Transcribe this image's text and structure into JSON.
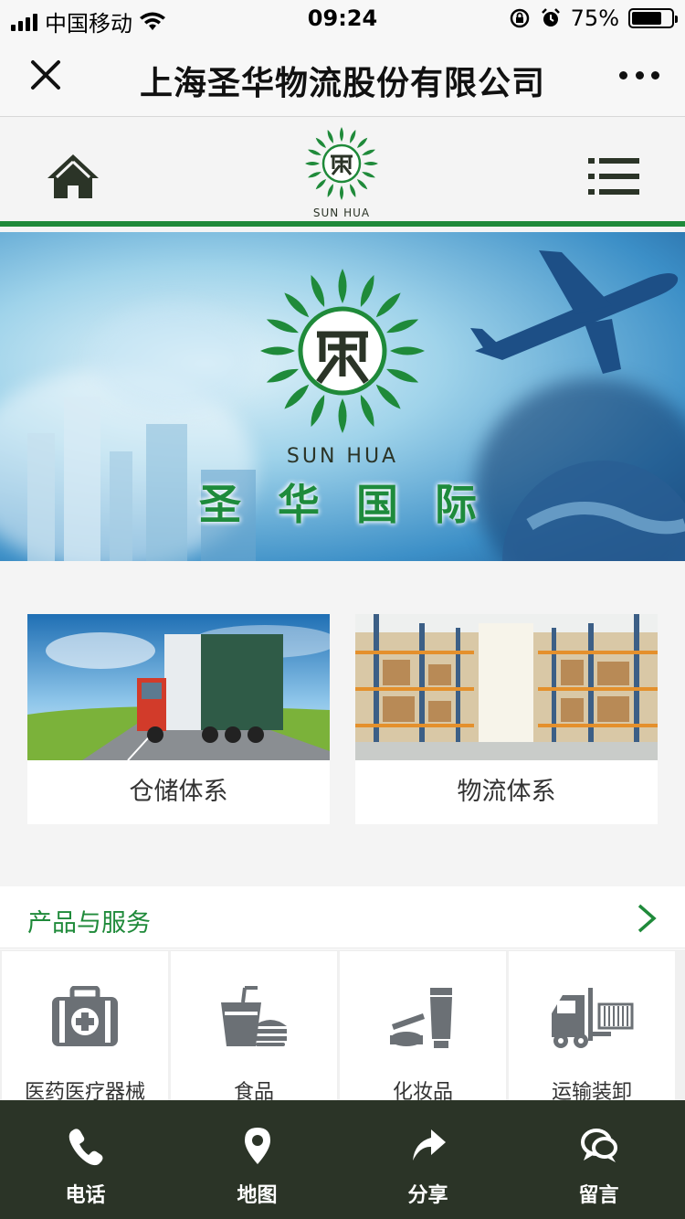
{
  "status_bar": {
    "carrier": "中国移动",
    "time": "09:24",
    "battery_text": "75%",
    "battery_level": 0.75
  },
  "nav": {
    "title": "上海圣华物流股份有限公司",
    "close_icon": "close-icon",
    "more_icon": "more-dots-icon"
  },
  "header": {
    "logo_text": "SUN HUA",
    "home_icon": "home-icon",
    "menu_icon": "menu-icon"
  },
  "banner": {
    "logo_text": "SUN HUA",
    "title": "圣华国际"
  },
  "cards": [
    {
      "label": "仓储体系",
      "image": "truck-on-road"
    },
    {
      "label": "物流体系",
      "image": "warehouse-shelves"
    }
  ],
  "products": {
    "title": "产品与服务",
    "items": [
      {
        "label": "医药医疗器械",
        "icon": "medical-kit-icon"
      },
      {
        "label": "食品",
        "icon": "food-icon"
      },
      {
        "label": "化妆品",
        "icon": "cosmetics-icon"
      },
      {
        "label": "运输装卸",
        "icon": "forklift-icon"
      }
    ]
  },
  "tabbar": [
    {
      "label": "电话",
      "icon": "phone-icon"
    },
    {
      "label": "地图",
      "icon": "map-pin-icon"
    },
    {
      "label": "分享",
      "icon": "share-icon"
    },
    {
      "label": "留言",
      "icon": "message-icon"
    }
  ],
  "colors": {
    "brand_green": "#1f8a3a",
    "tabbar_bg": "#2b3427",
    "icon_gray": "#6b7075"
  }
}
